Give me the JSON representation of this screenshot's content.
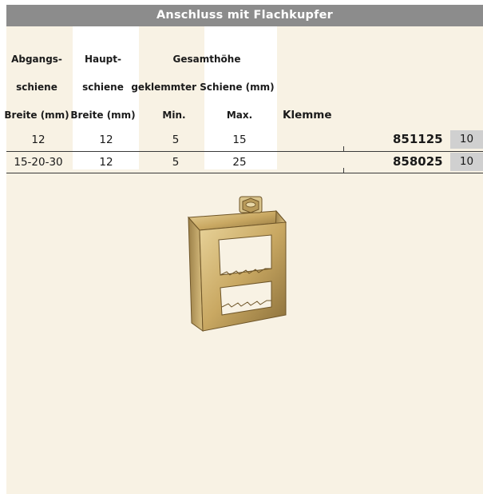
{
  "title": "Anschluss mit Flachkupfer",
  "headers": {
    "abgang_line1": "Abgangs-",
    "abgang_line2": "schiene",
    "abgang_line3": "Breite (mm)",
    "haupt_line1": "Haupt-",
    "haupt_line2": "schiene",
    "haupt_line3": "Breite (mm)",
    "gesamt_line1": "Gesamthöhe",
    "gesamt_line2": "geklemmter Schiene (mm)",
    "min": "Min.",
    "max": "Max.",
    "klemme": "Klemme"
  },
  "rows": [
    {
      "abgang": "12",
      "haupt": "12",
      "min": "5",
      "max": "15",
      "code": "851125",
      "qty": "10"
    },
    {
      "abgang": "15-20-30",
      "haupt": "12",
      "min": "5",
      "max": "25",
      "code": "858025",
      "qty": "10"
    }
  ],
  "colors": {
    "title_bar": "#8c8c8c",
    "page_background": "#f8f2e4",
    "qty_cell": "#d0d0d0",
    "clamp_metal": "#c9a862"
  },
  "image": {
    "icon": "flat-copper-clamp-illustration"
  }
}
